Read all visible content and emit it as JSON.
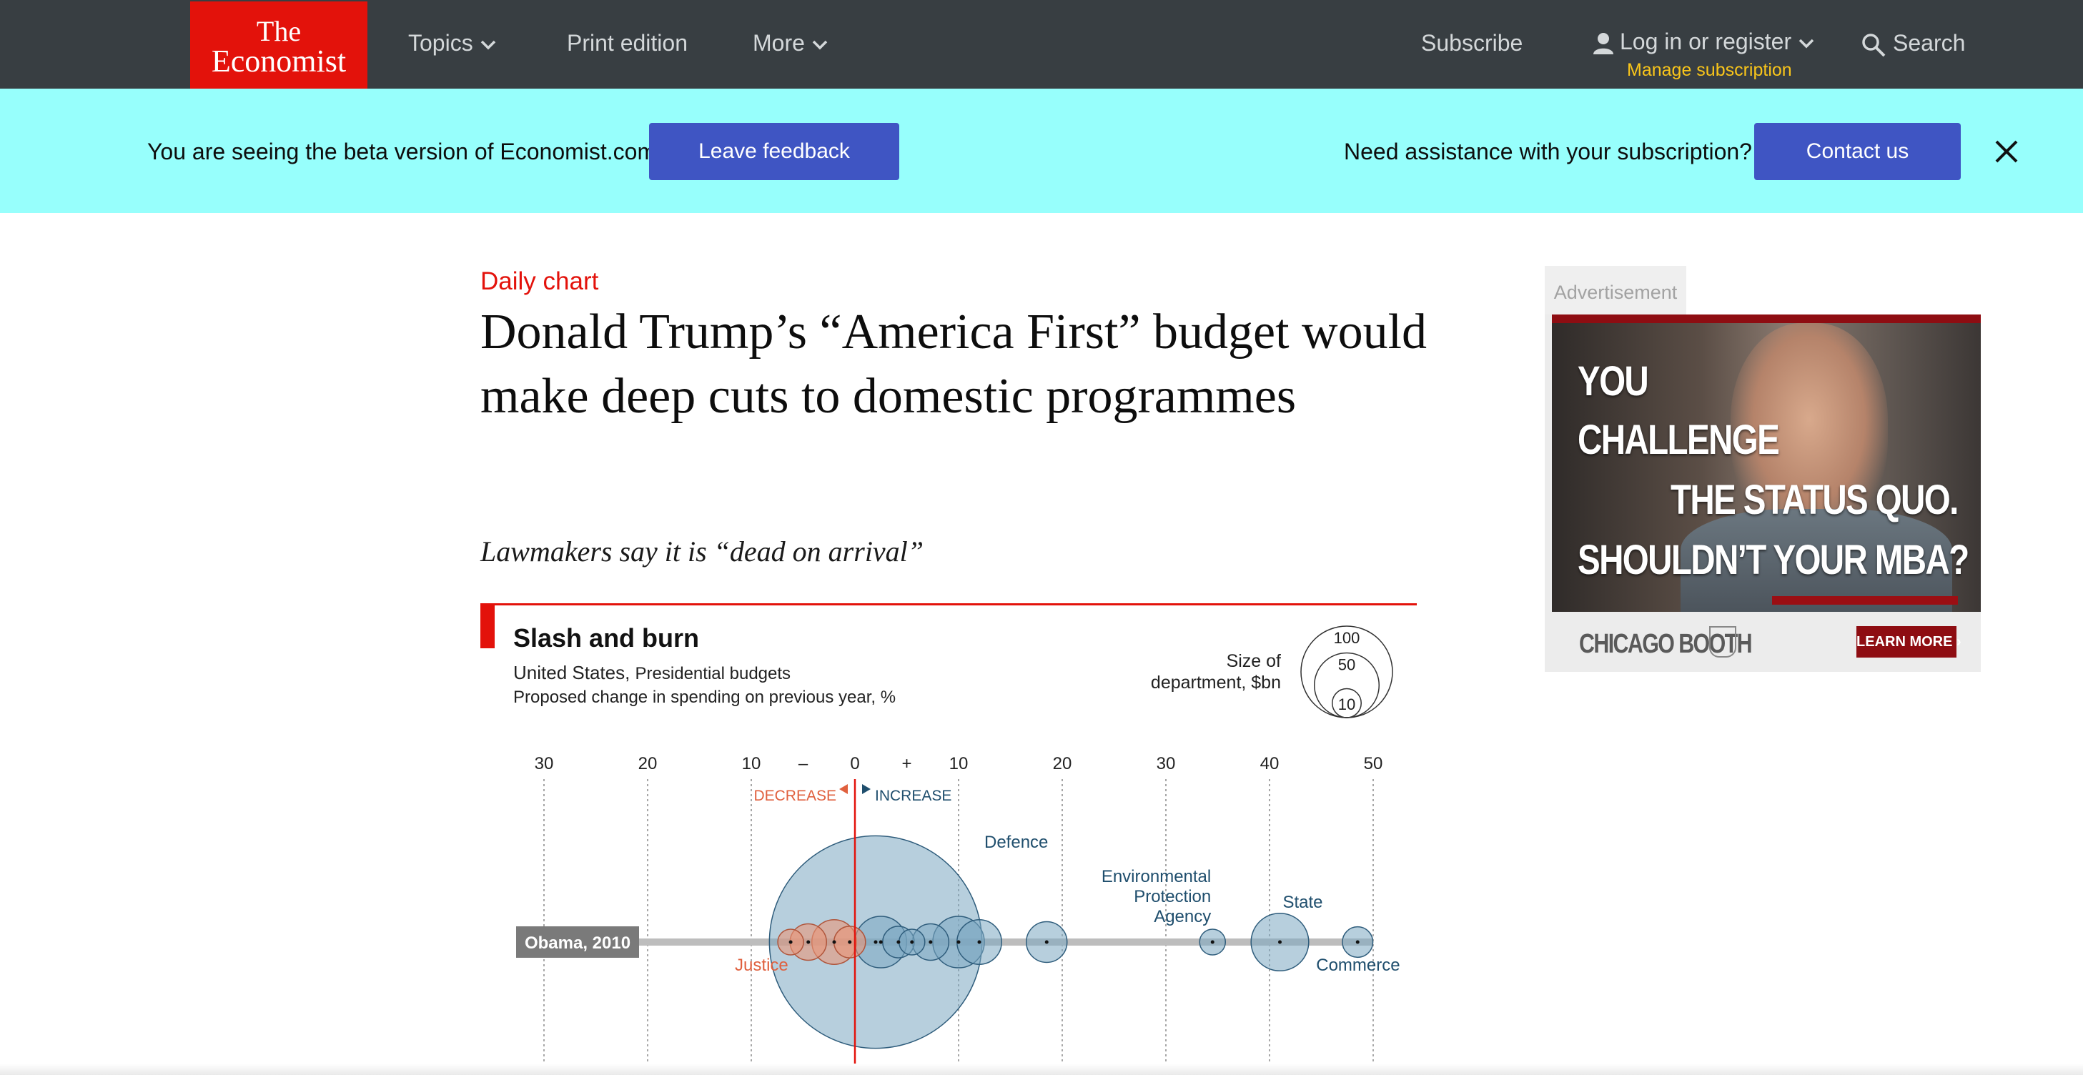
{
  "nav": {
    "logo_line1": "The",
    "logo_line2": "Economist",
    "topics": "Topics",
    "print_edition": "Print edition",
    "more": "More",
    "subscribe": "Subscribe",
    "login": "Log in or register",
    "manage_subscription": "Manage subscription",
    "search": "Search"
  },
  "banner": {
    "beta_text": "You are seeing the beta version of Economist.com",
    "feedback_button": "Leave feedback",
    "assist_text": "Need assistance with your subscription?",
    "contact_button": "Contact us"
  },
  "article": {
    "kicker": "Daily chart",
    "headline": "Donald Trump’s “America First” budget would make deep cuts to domestic programmes",
    "subheadline": "Lawmakers say it is “dead on arrival”"
  },
  "ad": {
    "label": "Advertisement",
    "lines": [
      "YOU",
      "CHALLENGE",
      "THE STATUS QUO.",
      "SHOULDN’T YOUR MBA?"
    ],
    "brand": "CHICAGO BOOTH",
    "cta": "LEARN MORE ›"
  },
  "colors": {
    "nav_bg": "#383e42",
    "brand_red": "#e3120b",
    "banner_bg": "#97fffc",
    "button_blue": "#3f55c3",
    "increase_blue": "#7ba7c1",
    "decrease_red": "#e9967a"
  },
  "chart_data": {
    "type": "scatter",
    "title": "Slash and burn",
    "subtitle_country": "United States,",
    "subtitle_detail": "Presidential budgets",
    "subtitle_measure": "Proposed change in spending on previous year, %",
    "size_legend_label": "Size of department, $bn",
    "size_legend_values": [
      100,
      50,
      10
    ],
    "x_tick_labels": [
      "30",
      "20",
      "10",
      "–",
      "0",
      "+",
      "10",
      "20",
      "30",
      "40",
      "50"
    ],
    "x_ticks": [
      -30,
      -20,
      -10,
      0,
      10,
      20,
      30,
      40,
      50
    ],
    "xlim": [
      -30,
      50
    ],
    "decrease_label": "DECREASE",
    "increase_label": "INCREASE",
    "row_label": "Obama, 2010",
    "points": [
      {
        "label": "",
        "x": -6.2,
        "size": 10
      },
      {
        "label": "Justice",
        "x": -4.5,
        "size": 20
      },
      {
        "label": "",
        "x": -2.0,
        "size": 30
      },
      {
        "label": "",
        "x": -0.5,
        "size": 15
      },
      {
        "label": "Defence",
        "x": 2.0,
        "size": 680
      },
      {
        "label": "",
        "x": 2.5,
        "size": 40
      },
      {
        "label": "",
        "x": 4.2,
        "size": 15
      },
      {
        "label": "",
        "x": 5.5,
        "size": 10
      },
      {
        "label": "",
        "x": 7.3,
        "size": 20
      },
      {
        "label": "",
        "x": 10.0,
        "size": 40
      },
      {
        "label": "",
        "x": 12.0,
        "size": 30
      },
      {
        "label": "",
        "x": 18.5,
        "size": 25
      },
      {
        "label": "Environmental Protection Agency",
        "x": 34.5,
        "size": 10
      },
      {
        "label": "State",
        "x": 41.0,
        "size": 50
      },
      {
        "label": "Commerce",
        "x": 48.5,
        "size": 14
      }
    ]
  }
}
